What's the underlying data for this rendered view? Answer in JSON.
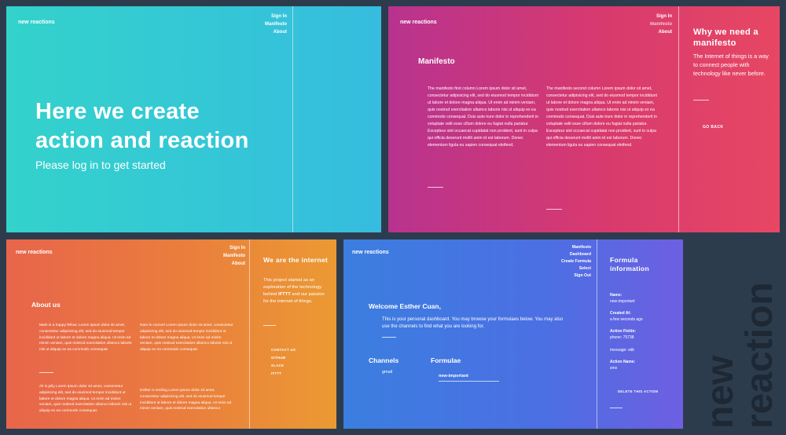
{
  "brand": "new reactions",
  "home": {
    "nav": [
      "Sign In",
      "Manifesto",
      "About"
    ],
    "headline_line1": "Here we create",
    "headline_line2": "action and reaction",
    "subtitle": "Please log in to get started"
  },
  "manifesto": {
    "nav": [
      "Sign In",
      "Manifesto",
      "About"
    ],
    "title": "Manifesto",
    "col1": "The manifesto first column Lorem ipsum dolor sit amet, consectetur adipisicing elit, sed do eiusmod tempor incididunt ut labore et dolore magna aliqua. Ut enim ad minim veniam, quis nostrud exercitation ullamco laboris nisi ut aliquip ex ea commodo consequat. Duis aute irure dolor in reprehenderit in voluptate velit esse cillum dolore eu fugiat nulla pariatur. Excepteur sint occaecat cupidatat non proident, sunt in culpa qui officia deserunt mollit anim id est laborum. Donec elementum ligula eu sapien consequat eleifend.",
    "col2": "The manifesto second column Lorem ipsum dolor sit amet, consectetur adipisicing elit, sed do eiusmod tempor incididunt ut labore et dolore magna aliqua. Ut enim ad minim veniam, quis nostrud exercitation ullamco laboris nisi ut aliquip ex ea commodo consequat. Duis aute irure dolor in reprehenderit in voluptate velit esse cillum dolore eu fugiat nulla pariatur. Excepteur sint occaecat cupidatat non proident, sunt in culpa qui officia deserunt mollit anim id est laborum. Donec elementum ligula eu sapien consequat eleifend.",
    "side_title": "Why we need a manifesto",
    "side_text": "The Internet of things is a way to connect people with technology like never before.",
    "go_back": "GO BACK"
  },
  "about": {
    "nav": [
      "Sign In",
      "Manifesto",
      "About"
    ],
    "title": "About us",
    "para1": "Mark is a happy fellow. Lorem ipsum dolor sit amet, consectetur adipisicing elit, sed do eiusmod tempor incididunt ut labore et dolore magna aliqua. Ut enim ad minim veniam, quis nostrud exercitation ullamco laboris nisi ut aliquip ex ea commodo consequat.",
    "para2": "Nam is concert Lorem ipsum dolor sit amet, consectetur adipisicing elit, sed do eiusmod tempor incididunt ut labore et dolore magna aliqua. Ut enim ad minim veniam, quis nostrud exercitation ullamco laboris nisi ut aliquip ex ea commodo consequat.",
    "para3": "Ali is jolly Lorem ipsum dolor sit amet, consectetur adipisicing elit, sed do eiusmod tempor incididunt ut labore et dolore magna aliqua. Ut enim ad minim veniam, quis nostrud exercitation ullamco laboris nisi ut aliquip ex ea commodo consequat.",
    "para4": "Esther is smiling Lorem ipsum dolor sit amet, consectetur adipisicing elit, sed do eiusmod tempor incididunt ut labore et dolore magna aliqua. Ut enim ad minim veniam, quis nostrud exercitation ullamco",
    "side_title": "We are the internet",
    "side_text_before": "This project started as an exploration of the technology behind ",
    "side_text_bold": "IFTTT",
    "side_text_after": " and our passion for the internet of things.",
    "links": [
      "CONTACT US",
      "GITHUB",
      "SLACK",
      "IFTTT"
    ]
  },
  "dashboard": {
    "nav": [
      "Manifesto",
      "Dashboard",
      "Create Formula",
      "Select",
      "Sign Out"
    ],
    "welcome": "Welcome Esther Cuan,",
    "intro": "This is your personal dashboard. You may browse your formulaes below. You may also use the channels to find what you are looking for.",
    "channels_title": "Channels",
    "channels": [
      "gmail"
    ],
    "formulae_title": "Formulae",
    "formulae": [
      "new-important"
    ],
    "side_title": "Formula information",
    "fields": [
      {
        "label": "Name:",
        "value": "new-important"
      },
      {
        "label": "Created At:",
        "value": "a few seconds ago"
      },
      {
        "label": "Action Fields:",
        "value": "phone: 75738"
      },
      {
        "label": "",
        "value": "message: sdk"
      },
      {
        "label": "Action Name:",
        "value": "sms"
      }
    ],
    "delete": "DELETE THIS ACTION"
  },
  "watermark": [
    "new",
    "reaction"
  ]
}
